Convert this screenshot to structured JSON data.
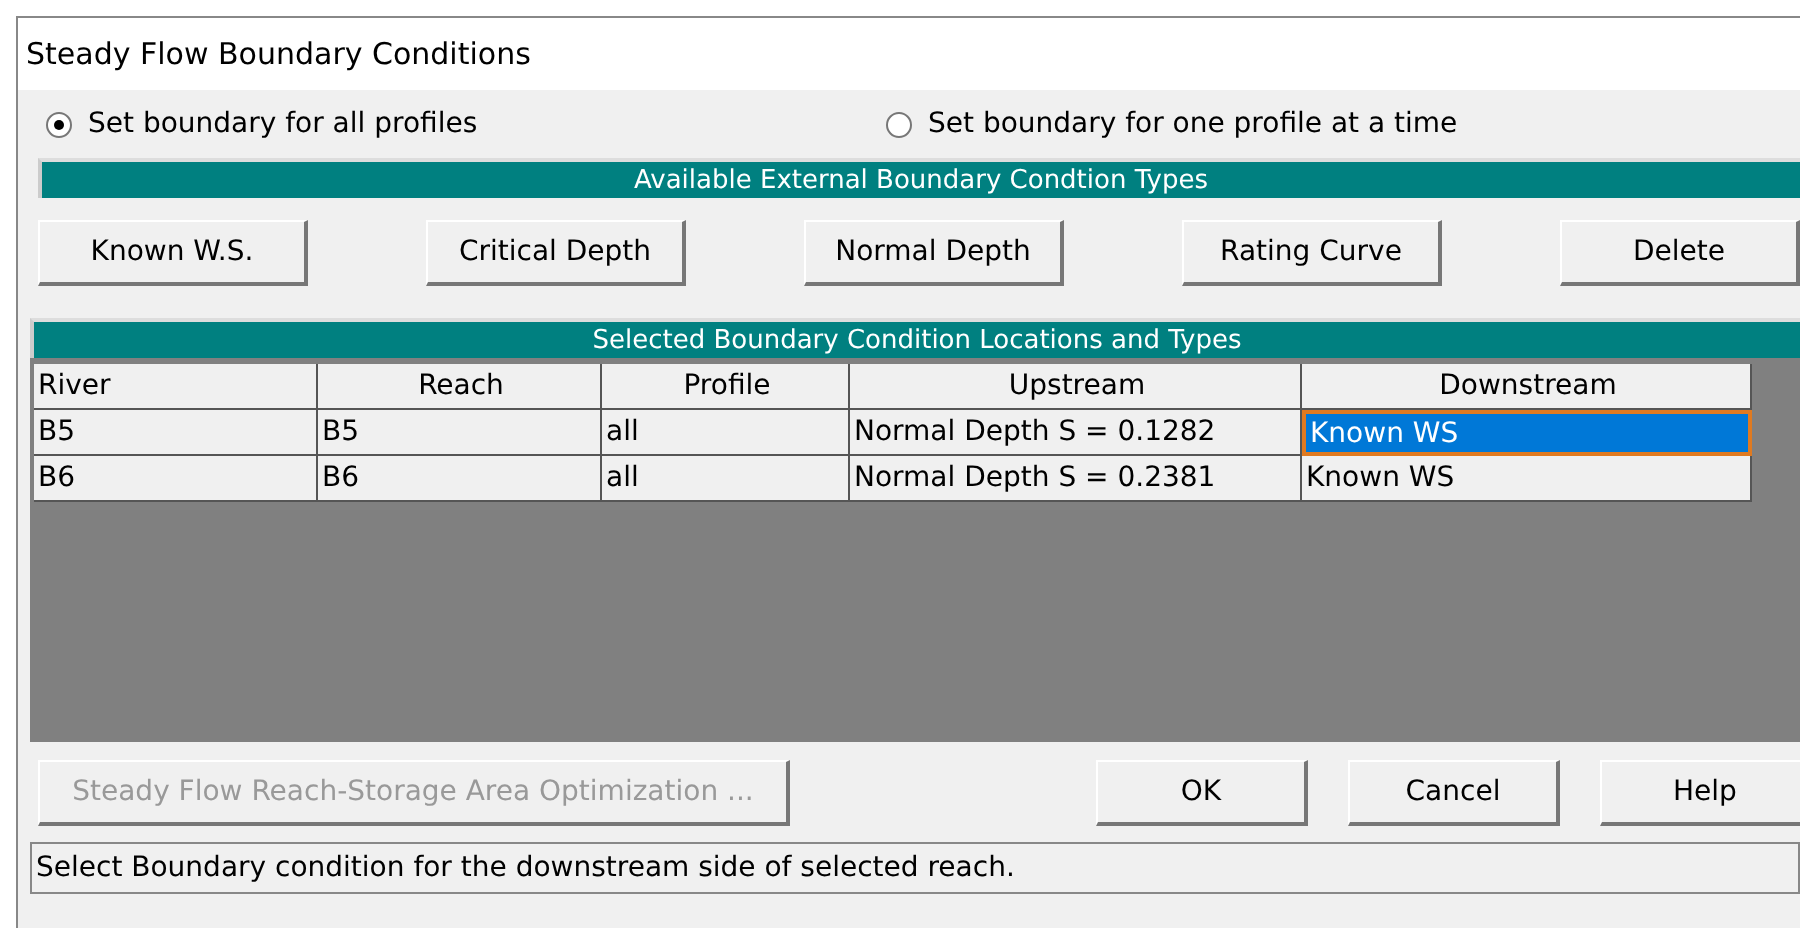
{
  "window": {
    "title": "Steady Flow Boundary Conditions"
  },
  "mode_options": [
    {
      "label": "Set boundary for all profiles",
      "selected": true
    },
    {
      "label": "Set boundary for one profile at a time",
      "selected": false
    }
  ],
  "types_header": "Available External Boundary Condtion Types",
  "type_buttons": [
    "Known W.S.",
    "Critical Depth",
    "Normal Depth",
    "Rating Curve",
    "Delete"
  ],
  "table": {
    "title": "Selected Boundary Condition Locations and Types",
    "columns": [
      "River",
      "Reach",
      "Profile",
      "Upstream",
      "Downstream"
    ],
    "rows": [
      {
        "cells": [
          {
            "text": "B5",
            "selected": false
          },
          {
            "text": "B5",
            "selected": false
          },
          {
            "text": "all",
            "selected": false
          },
          {
            "text": "Normal Depth S = 0.1282",
            "selected": false
          },
          {
            "text": "Known WS",
            "selected": true
          }
        ]
      },
      {
        "cells": [
          {
            "text": "B6",
            "selected": false
          },
          {
            "text": "B6",
            "selected": false
          },
          {
            "text": "all",
            "selected": false
          },
          {
            "text": "Normal Depth S = 0.2381",
            "selected": false
          },
          {
            "text": "Known WS",
            "selected": false
          }
        ]
      }
    ]
  },
  "optimization_button": {
    "label": "Steady Flow Reach-Storage Area Optimization ...",
    "disabled": true
  },
  "dialog_buttons": [
    "OK",
    "Cancel",
    "Help"
  ],
  "status_bar": "Select Boundary condition for the downstream side of selected reach."
}
